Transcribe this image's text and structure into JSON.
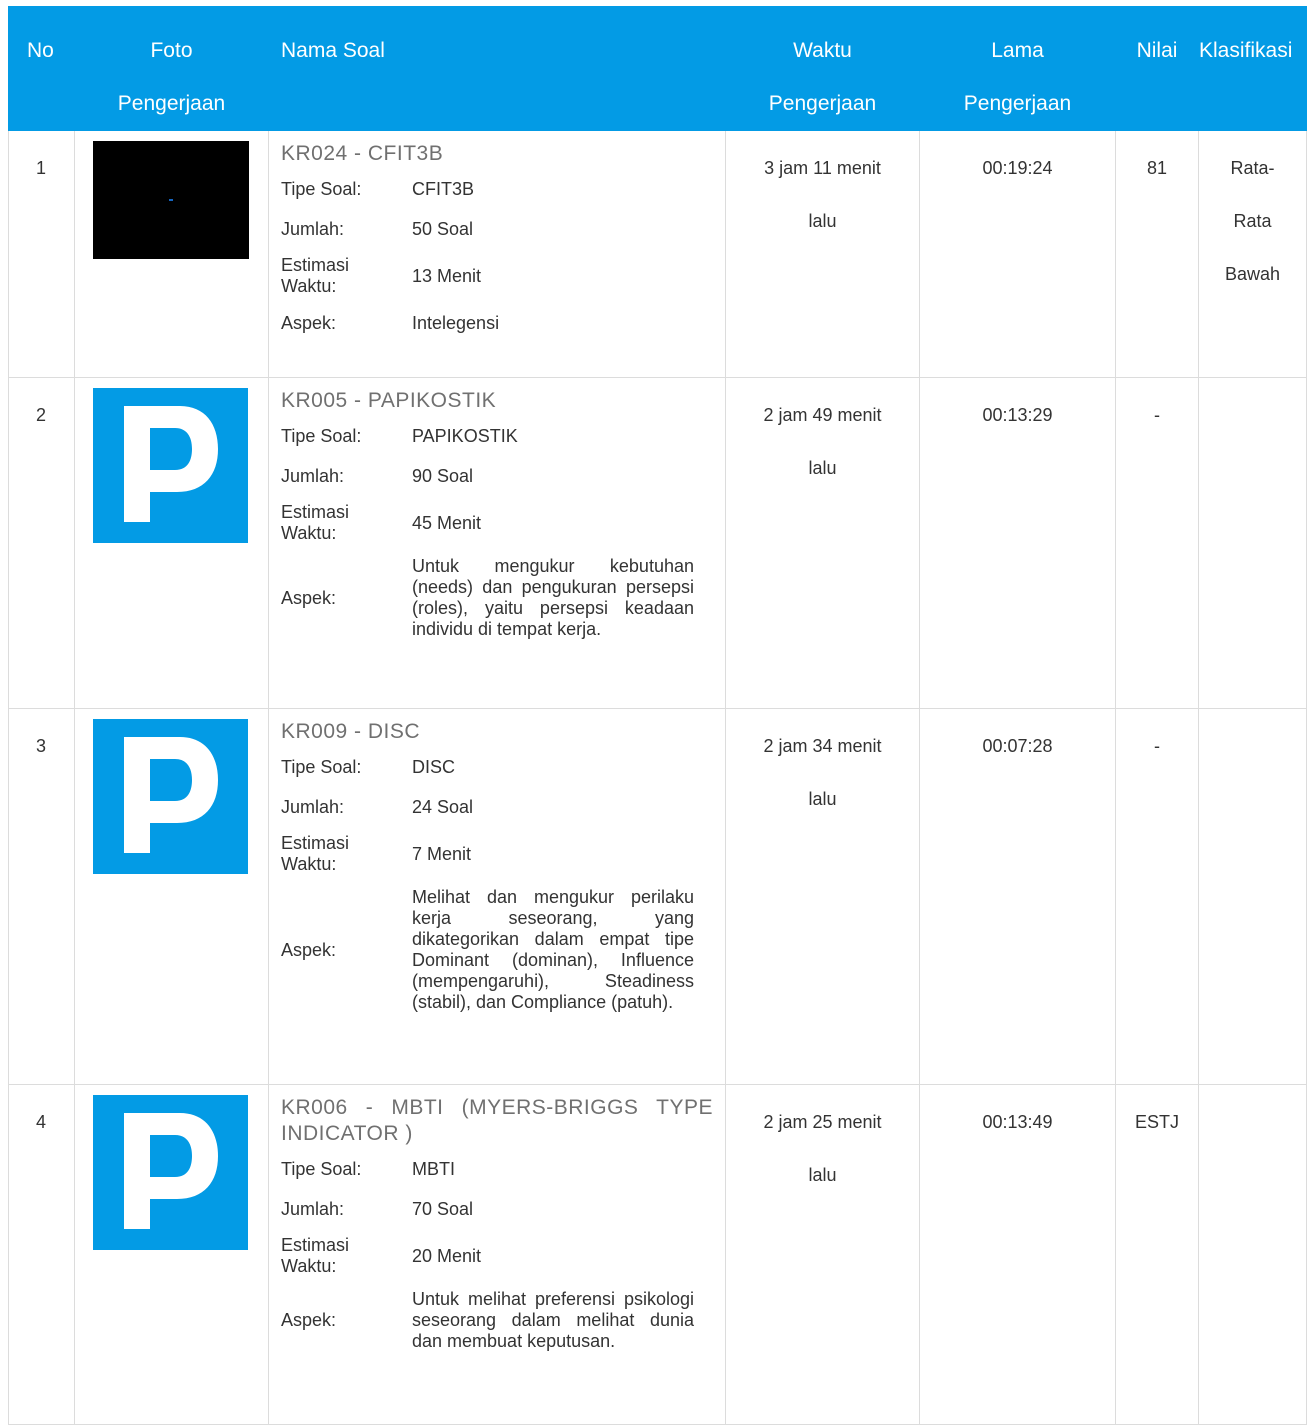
{
  "headers": {
    "no": "No",
    "foto": [
      "Foto",
      "Pengerjaan"
    ],
    "nama": "Nama Soal",
    "waktu": [
      "Waktu",
      "Pengerjaan"
    ],
    "lama": [
      "Lama",
      "Pengerjaan"
    ],
    "nilai": "Nilai",
    "klasifikasi": "Klasifikasi"
  },
  "labels": {
    "tipe": "Tipe Soal:",
    "jumlah": "Jumlah:",
    "estimasi": [
      "Estimasi",
      "Waktu:"
    ],
    "aspek": "Aspek:"
  },
  "rows": [
    {
      "no": "1",
      "foto": "black-thumbnail",
      "title": "KR024 - CFIT3B",
      "tipe": "CFIT3B",
      "jumlah": "50 Soal",
      "estimasi": "13 Menit",
      "aspek": "Intelegensi",
      "waktu": [
        "3 jam 11 menit",
        "lalu"
      ],
      "lama": "00:19:24",
      "nilai": "81",
      "klasifikasi": [
        "Rata-",
        "Rata",
        "Bawah"
      ]
    },
    {
      "no": "2",
      "foto": "p-logo",
      "title": "KR005 - PAPIKOSTIK",
      "tipe": "PAPIKOSTIK",
      "jumlah": "90 Soal",
      "estimasi": "45 Menit",
      "aspek": "Untuk mengukur kebutuhan (needs) dan pengukuran persepsi (roles), yaitu persepsi keadaan individu di tempat kerja.",
      "waktu": [
        "2 jam 49 menit",
        "lalu"
      ],
      "lama": "00:13:29",
      "nilai": "-",
      "klasifikasi": []
    },
    {
      "no": "3",
      "foto": "p-logo",
      "title": "KR009 - DISC",
      "tipe": "DISC",
      "jumlah": "24 Soal",
      "estimasi": "7 Menit",
      "aspek": "Melihat dan mengukur perilaku kerja seseorang, yang dikategorikan dalam empat tipe Dominant (dominan), Influence (mempengaruhi), Steadiness (stabil), dan Compliance (patuh).",
      "waktu": [
        "2 jam 34 menit",
        "lalu"
      ],
      "lama": "00:07:28",
      "nilai": "-",
      "klasifikasi": []
    },
    {
      "no": "4",
      "foto": "p-logo",
      "title": "KR006 - MBTI (MYERS-BRIGGS TYPE INDICATOR )",
      "tipe": "MBTI",
      "jumlah": "70 Soal",
      "estimasi": "20 Menit",
      "aspek": "Untuk melihat preferensi psikologi seseorang dalam melihat dunia dan membuat keputusan.",
      "waktu": [
        "2 jam 25 menit",
        "lalu"
      ],
      "lama": "00:13:49",
      "nilai": "ESTJ",
      "klasifikasi": []
    }
  ],
  "colors": {
    "header_bg": "#039be5",
    "logo_bg": "#039be5"
  }
}
